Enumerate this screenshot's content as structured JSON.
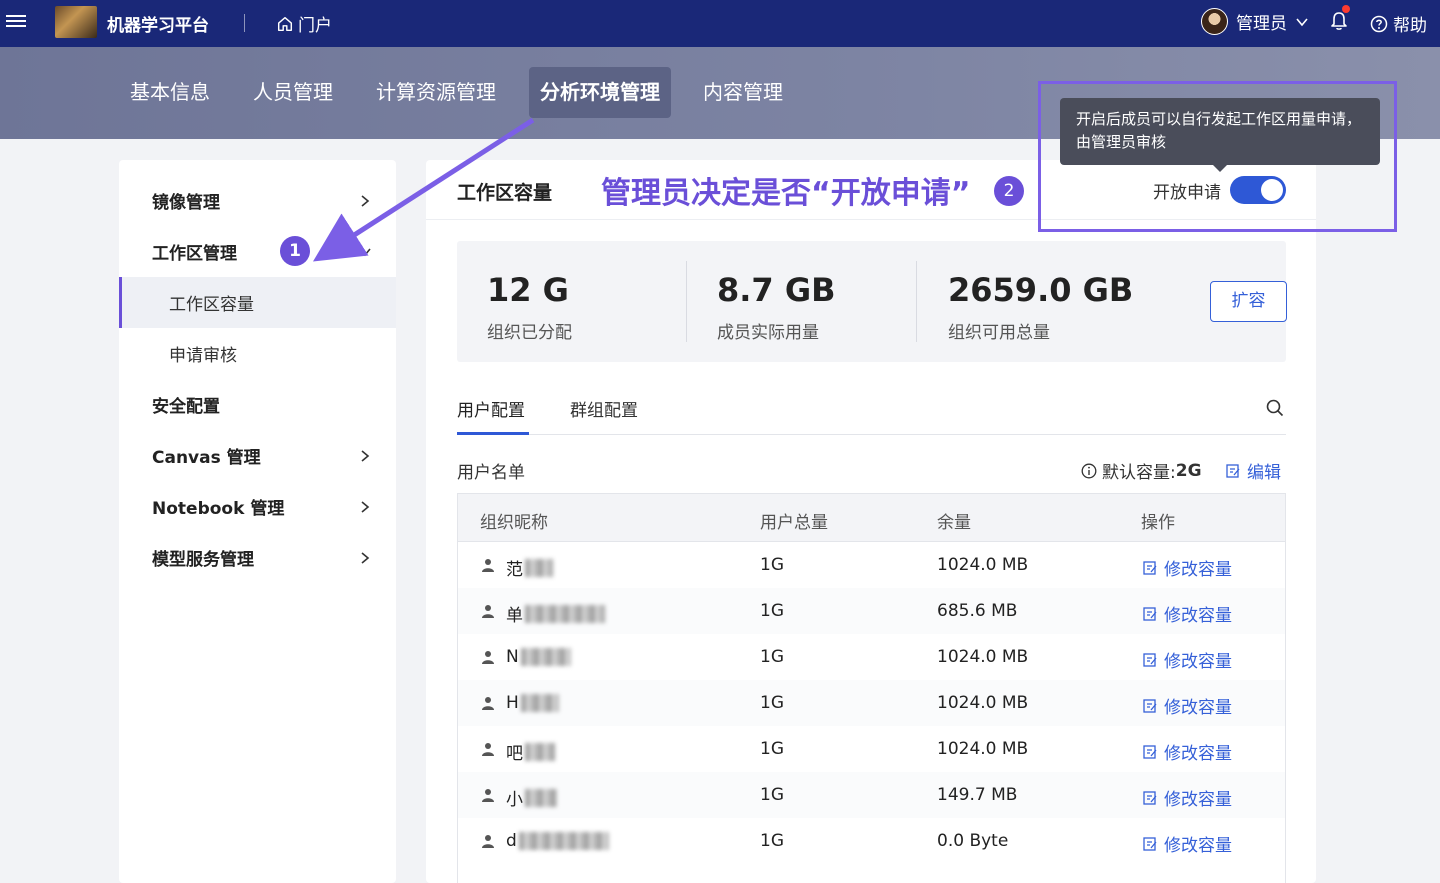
{
  "topbar": {
    "app_title": "机器学习平台",
    "portal_label": "门户",
    "user_name": "管理员",
    "help_label": "帮助"
  },
  "subnav": {
    "tabs": [
      {
        "label": "基本信息",
        "active": false
      },
      {
        "label": "人员管理",
        "active": false
      },
      {
        "label": "计算资源管理",
        "active": false
      },
      {
        "label": "分析环境管理",
        "active": true
      },
      {
        "label": "内容管理",
        "active": false
      }
    ]
  },
  "sidebar": {
    "items": [
      {
        "label": "镜像管理",
        "has_arrow": "right"
      },
      {
        "label": "工作区管理",
        "has_arrow": "down"
      },
      {
        "label": "工作区容量",
        "sub": true,
        "active": true
      },
      {
        "label": "申请审核",
        "sub": true
      },
      {
        "label": "安全配置"
      },
      {
        "label": "Canvas 管理",
        "has_arrow": "right"
      },
      {
        "label": "Notebook 管理",
        "has_arrow": "right"
      },
      {
        "label": "模型服务管理",
        "has_arrow": "right"
      }
    ],
    "step_badge": "1"
  },
  "main": {
    "title": "工作区容量",
    "annotation": "管理员决定是否“开放申请”",
    "annotation_badge": "2",
    "toggle_label": "开放申请",
    "toggle_on": true,
    "tooltip": "开启后成员可以自行发起工作区用量申请，由管理员审核",
    "stats": [
      {
        "value": "12 G",
        "label": "组织已分配"
      },
      {
        "value": "8.7 GB",
        "label": "成员实际用量"
      },
      {
        "value": "2659.0 GB",
        "label": "组织可用总量"
      }
    ],
    "expand_button": "扩容",
    "tabs": [
      {
        "label": "用户配置",
        "active": true
      },
      {
        "label": "群组配置",
        "active": false
      }
    ],
    "list_title": "用户名单",
    "default_capacity_label": "默认容量:",
    "default_capacity_value": "2G",
    "edit_label": "编辑",
    "table": {
      "headers": [
        "组织昵称",
        "用户总量",
        "余量",
        "操作"
      ],
      "rows": [
        {
          "name": "范",
          "total": "1G",
          "remaining": "1024.0 MB",
          "action": "修改容量"
        },
        {
          "name": "单",
          "total": "1G",
          "remaining": "685.6 MB",
          "action": "修改容量"
        },
        {
          "name": "N",
          "total": "1G",
          "remaining": "1024.0 MB",
          "action": "修改容量"
        },
        {
          "name": "H",
          "total": "1G",
          "remaining": "1024.0 MB",
          "action": "修改容量"
        },
        {
          "name": "吧",
          "total": "1G",
          "remaining": "1024.0 MB",
          "action": "修改容量"
        },
        {
          "name": "小",
          "total": "1G",
          "remaining": "149.7 MB",
          "action": "修改容量"
        },
        {
          "name": "d",
          "total": "1G",
          "remaining": "0.0 Byte",
          "action": "修改容量"
        }
      ]
    }
  },
  "colors": {
    "topbar": "#1a2878",
    "accent_purple": "#6a4fd8",
    "link_blue": "#3560d8",
    "toggle_blue": "#2e58d6"
  }
}
